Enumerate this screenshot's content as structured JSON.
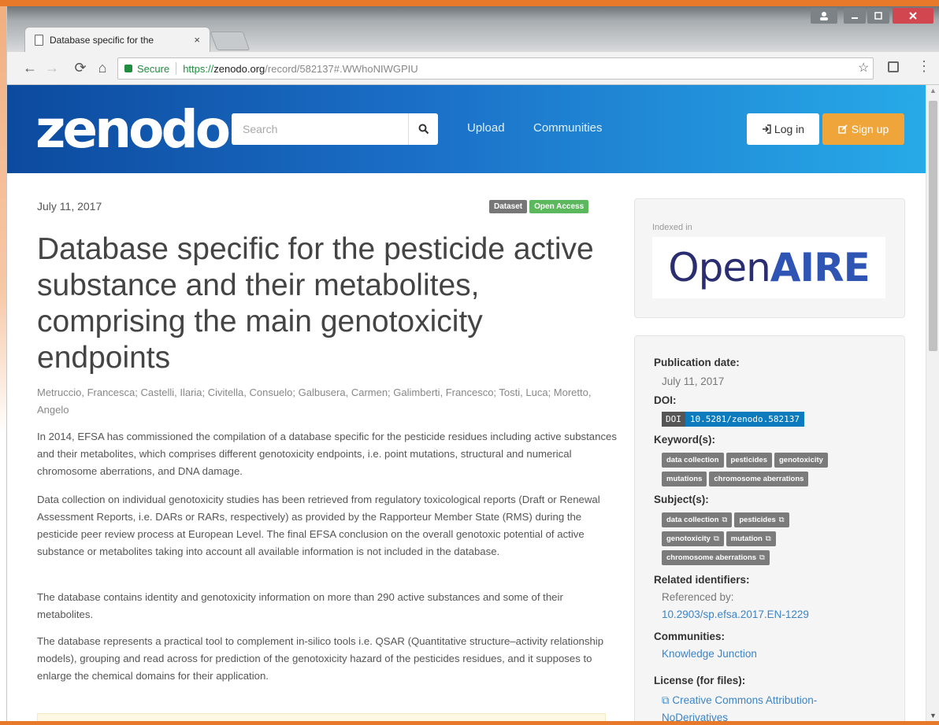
{
  "browser": {
    "tab_title": "Database specific for the",
    "tab_close": "×",
    "secure_label": "Secure",
    "url_scheme": "https://",
    "url_host": "zenodo.org",
    "url_path": "/record/582137#.WWhoNIWGPIU",
    "star_icon": "star-icon",
    "menu_icon": "⋮"
  },
  "header": {
    "logo": "zenodo",
    "search_placeholder": "Search",
    "nav": {
      "upload": "Upload",
      "communities": "Communities"
    },
    "login_label": "Log in",
    "signup_label": "Sign up",
    "colors": {
      "gradient_start": "#0c4a9e",
      "gradient_end": "#27aae8",
      "signup": "#f0a53b"
    }
  },
  "record": {
    "date": "July 11, 2017",
    "badges": {
      "type": "Dataset",
      "access": "Open Access"
    },
    "title": "Database specific for the pesticide active substance and their metabolites, comprising the main genotoxicity endpoints",
    "authors": "Metruccio, Francesca; Castelli, Ilaria; Civitella, Consuelo; Galbusera, Carmen; Galimberti, Francesco; Tosti, Luca; Moretto, Angelo",
    "description": [
      "In 2014, EFSA has commissioned the compilation of a database specific for the pesticide residues including active substances and their metabolites, which comprises different genotoxicity endpoints, i.e. point mutations, structural and numerical chromosome aberrations, and DNA damage.",
      "Data collection on individual genotoxicity studies has been retrieved from regulatory toxicological reports (Draft or Renewal Assessment Reports, i.e. DARs or RARs, respectively) as provided by the Rapporteur Member State (RMS) during the pesticide peer review process at European Level. The final EFSA conclusion on the overall genotoxic potential of active substance or metabolites taking into account all available information is not included in the database.",
      "The database contains identity and genotoxicity information on more than 290 active substances and some of their metabolites.",
      "The database represents a practical tool to complement in-silico tools i.e. QSAR (Quantitative structure–activity relationship models), grouping and read across for prediction of the genotoxicity hazard of the pesticides residues, and it supposes to enlarge the chemical domains for their application."
    ]
  },
  "sidebar": {
    "indexed_in": "Indexed in",
    "openaire": {
      "part1": "Open",
      "part2": "AIRE"
    },
    "publication_date_label": "Publication date:",
    "publication_date": "July 11, 2017",
    "doi_label": "DOI:",
    "doi_key": "DOI",
    "doi_value": "10.5281/zenodo.582137",
    "keywords_label": "Keyword(s):",
    "keywords": [
      "data collection",
      "pesticides",
      "genotoxicity",
      "mutations",
      "chromosome aberrations"
    ],
    "subjects_label": "Subject(s):",
    "subjects": [
      "data collection",
      "pesticides",
      "genotoxicity",
      "mutation",
      "chromosome aberrations"
    ],
    "related_label": "Related identifiers:",
    "referenced_by_label": "Referenced by:",
    "referenced_by": "10.2903/sp.efsa.2017.EN-1229",
    "communities_label": "Communities:",
    "community": "Knowledge Junction",
    "license_label": "License (for files):",
    "license": "Creative Commons Attribution-NoDerivatives"
  }
}
